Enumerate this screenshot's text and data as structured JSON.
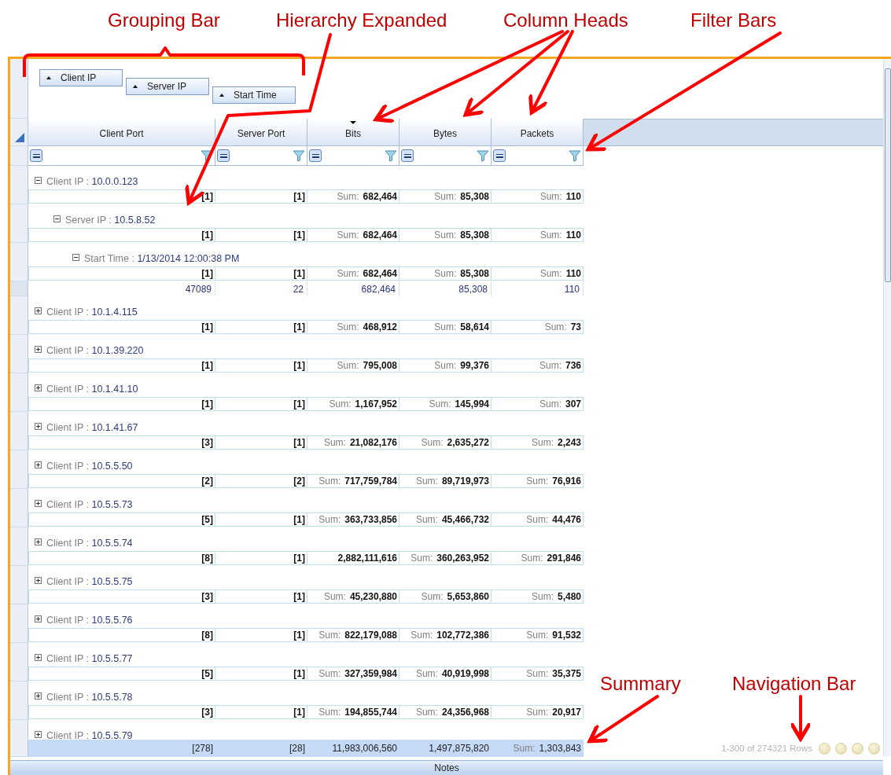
{
  "annotations": [
    {
      "text": "Grouping Bar"
    },
    {
      "text": "Hierarchy Expanded"
    },
    {
      "text": "Column Heads"
    },
    {
      "text": "Filter Bars"
    },
    {
      "text": "Summary"
    },
    {
      "text": "Navigation Bar"
    }
  ],
  "grouping_bar": [
    {
      "label": "Client IP"
    },
    {
      "label": "Server IP"
    },
    {
      "label": "Start Time"
    }
  ],
  "columns": [
    {
      "label": "Client Port",
      "sorted": false
    },
    {
      "label": "Server Port",
      "sorted": false
    },
    {
      "label": "Bits",
      "sorted": true
    },
    {
      "label": "Bytes",
      "sorted": false
    },
    {
      "label": "Packets",
      "sorted": false
    }
  ],
  "groups": [
    {
      "field": "Client IP :",
      "value": "10.0.0.123",
      "expanded": true,
      "summary": [
        {
          "value": "[1]"
        },
        {
          "value": "[1]"
        },
        {
          "prefix": "Sum:",
          "value": "682,464"
        },
        {
          "prefix": "Sum:",
          "value": "85,308"
        },
        {
          "prefix": "Sum:",
          "value": "110"
        }
      ],
      "children": [
        {
          "field": "Server IP :",
          "value": "10.5.8.52",
          "expanded": true,
          "summary": [
            {
              "value": "[1]"
            },
            {
              "value": "[1]"
            },
            {
              "prefix": "Sum:",
              "value": "682,464"
            },
            {
              "prefix": "Sum:",
              "value": "85,308"
            },
            {
              "prefix": "Sum:",
              "value": "110"
            }
          ],
          "children": [
            {
              "field": "Start Time :",
              "value": "1/13/2014 12:00:38 PM",
              "expanded": true,
              "summary": [
                {
                  "value": "[1]"
                },
                {
                  "value": "[1]"
                },
                {
                  "prefix": "Sum:",
                  "value": "682,464"
                },
                {
                  "prefix": "Sum:",
                  "value": "85,308"
                },
                {
                  "prefix": "Sum:",
                  "value": "110"
                }
              ],
              "rows": [
                [
                  "47089",
                  "22",
                  "682,464",
                  "85,308",
                  "110"
                ]
              ]
            }
          ]
        }
      ]
    },
    {
      "field": "Client IP :",
      "value": "10.1.4.115",
      "expanded": false,
      "summary": [
        {
          "value": "[1]"
        },
        {
          "value": "[1]"
        },
        {
          "prefix": "Sum:",
          "value": "468,912"
        },
        {
          "prefix": "Sum:",
          "value": "58,614"
        },
        {
          "prefix": "Sum:",
          "value": "73"
        }
      ]
    },
    {
      "field": "Client IP :",
      "value": "10.1.39.220",
      "expanded": false,
      "summary": [
        {
          "value": "[1]"
        },
        {
          "value": "[1]"
        },
        {
          "prefix": "Sum:",
          "value": "795,008"
        },
        {
          "prefix": "Sum:",
          "value": "99,376"
        },
        {
          "prefix": "Sum:",
          "value": "736"
        }
      ]
    },
    {
      "field": "Client IP :",
      "value": "10.1.41.10",
      "expanded": false,
      "summary": [
        {
          "value": "[1]"
        },
        {
          "value": "[1]"
        },
        {
          "prefix": "Sum:",
          "value": "1,167,952"
        },
        {
          "prefix": "Sum:",
          "value": "145,994"
        },
        {
          "prefix": "Sum:",
          "value": "307"
        }
      ]
    },
    {
      "field": "Client IP :",
      "value": "10.1.41.67",
      "expanded": false,
      "summary": [
        {
          "value": "[3]"
        },
        {
          "value": "[1]"
        },
        {
          "prefix": "Sum:",
          "value": "21,082,176"
        },
        {
          "prefix": "Sum:",
          "value": "2,635,272"
        },
        {
          "prefix": "Sum:",
          "value": "2,243"
        }
      ]
    },
    {
      "field": "Client IP :",
      "value": "10.5.5.50",
      "expanded": false,
      "summary": [
        {
          "value": "[2]"
        },
        {
          "value": "[2]"
        },
        {
          "prefix": "Sum:",
          "value": "717,759,784"
        },
        {
          "prefix": "Sum:",
          "value": "89,719,973"
        },
        {
          "prefix": "Sum:",
          "value": "76,916"
        }
      ]
    },
    {
      "field": "Client IP :",
      "value": "10.5.5.73",
      "expanded": false,
      "summary": [
        {
          "value": "[5]"
        },
        {
          "value": "[1]"
        },
        {
          "prefix": "Sum:",
          "value": "363,733,856"
        },
        {
          "prefix": "Sum:",
          "value": "45,466,732"
        },
        {
          "prefix": "Sum:",
          "value": "44,476"
        }
      ]
    },
    {
      "field": "Client IP :",
      "value": "10.5.5.74",
      "expanded": false,
      "summary": [
        {
          "value": "[8]"
        },
        {
          "value": "[1]"
        },
        {
          "value": "2,882,111,616"
        },
        {
          "prefix": "Sum:",
          "value": "360,263,952"
        },
        {
          "prefix": "Sum:",
          "value": "291,846"
        }
      ]
    },
    {
      "field": "Client IP :",
      "value": "10.5.5.75",
      "expanded": false,
      "summary": [
        {
          "value": "[3]"
        },
        {
          "value": "[1]"
        },
        {
          "prefix": "Sum:",
          "value": "45,230,880"
        },
        {
          "prefix": "Sum:",
          "value": "5,653,860"
        },
        {
          "prefix": "Sum:",
          "value": "5,480"
        }
      ]
    },
    {
      "field": "Client IP :",
      "value": "10.5.5.76",
      "expanded": false,
      "summary": [
        {
          "value": "[8]"
        },
        {
          "value": "[1]"
        },
        {
          "prefix": "Sum:",
          "value": "822,179,088"
        },
        {
          "prefix": "Sum:",
          "value": "102,772,386"
        },
        {
          "prefix": "Sum:",
          "value": "91,532"
        }
      ]
    },
    {
      "field": "Client IP :",
      "value": "10.5.5.77",
      "expanded": false,
      "summary": [
        {
          "value": "[5]"
        },
        {
          "value": "[1]"
        },
        {
          "prefix": "Sum:",
          "value": "327,359,984"
        },
        {
          "prefix": "Sum:",
          "value": "40,919,998"
        },
        {
          "prefix": "Sum:",
          "value": "35,375"
        }
      ]
    },
    {
      "field": "Client IP :",
      "value": "10.5.5.78",
      "expanded": false,
      "summary": [
        {
          "value": "[3]"
        },
        {
          "value": "[1]"
        },
        {
          "prefix": "Sum:",
          "value": "194,855,744"
        },
        {
          "prefix": "Sum:",
          "value": "24,356,968"
        },
        {
          "prefix": "Sum:",
          "value": "20,917"
        }
      ]
    },
    {
      "field": "Client IP :",
      "value": "10.5.5.79",
      "expanded": false
    }
  ],
  "footer": [
    {
      "value": "[278]"
    },
    {
      "value": "[28]"
    },
    {
      "value": "11,983,006,560"
    },
    {
      "value": "1,497,875,820"
    },
    {
      "prefix": "Sum:",
      "value": "1,303,843"
    }
  ],
  "navigation": {
    "text": "1-300 of 274321 Rows"
  },
  "notes_bar": {
    "label": "Notes"
  }
}
